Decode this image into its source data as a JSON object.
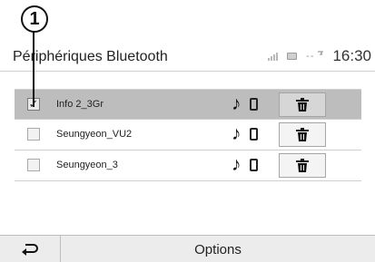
{
  "callout": {
    "number": "1"
  },
  "header": {
    "title": "Périphériques Bluetooth",
    "network": "--",
    "time": "16:30"
  },
  "devices": [
    {
      "name": "Info 2_3Gr",
      "checked": true,
      "icons": [
        "music-icon",
        "phone-icon"
      ],
      "delete_icon": "trash-icon"
    },
    {
      "name": "Seungyeon_VU2",
      "checked": false,
      "icons": [
        "music-icon",
        "phone-icon"
      ],
      "delete_icon": "trash-icon"
    },
    {
      "name": "Seungyeon_3",
      "checked": false,
      "icons": [
        "music-icon",
        "phone-icon"
      ],
      "delete_icon": "trash-icon"
    }
  ],
  "bottom_bar": {
    "back_icon": "back-arrow-icon",
    "options_label": "Options"
  },
  "colors": {
    "selected_row": "#bdbdbd",
    "bottom_bar": "#ececec",
    "divider": "#cfcfcf"
  }
}
